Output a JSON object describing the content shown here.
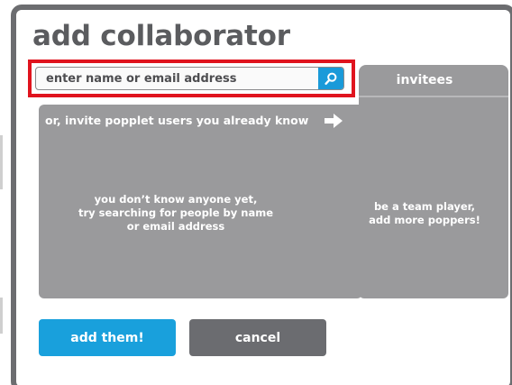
{
  "dialog": {
    "title": "add collaborator"
  },
  "search": {
    "placeholder": "enter name or email address",
    "value": "",
    "button_icon": "search-icon",
    "highlight_color": "#e0141e"
  },
  "users": {
    "heading": "or, invite popplet users you already know",
    "arrow_icon": "arrow-right-icon",
    "empty_lines": [
      "you don’t know anyone yet,",
      "try searching for people by name",
      "or email address"
    ]
  },
  "invitees": {
    "title": "invitees",
    "empty_lines": [
      "be a team player,",
      "add more poppers!"
    ]
  },
  "actions": {
    "add_label": "add them!",
    "cancel_label": "cancel"
  },
  "colors": {
    "accent_blue": "#19a0dc",
    "frame_gray": "#6c6d70",
    "panel_gray": "#9a9a9c",
    "title_gray": "#5b5c5f"
  }
}
